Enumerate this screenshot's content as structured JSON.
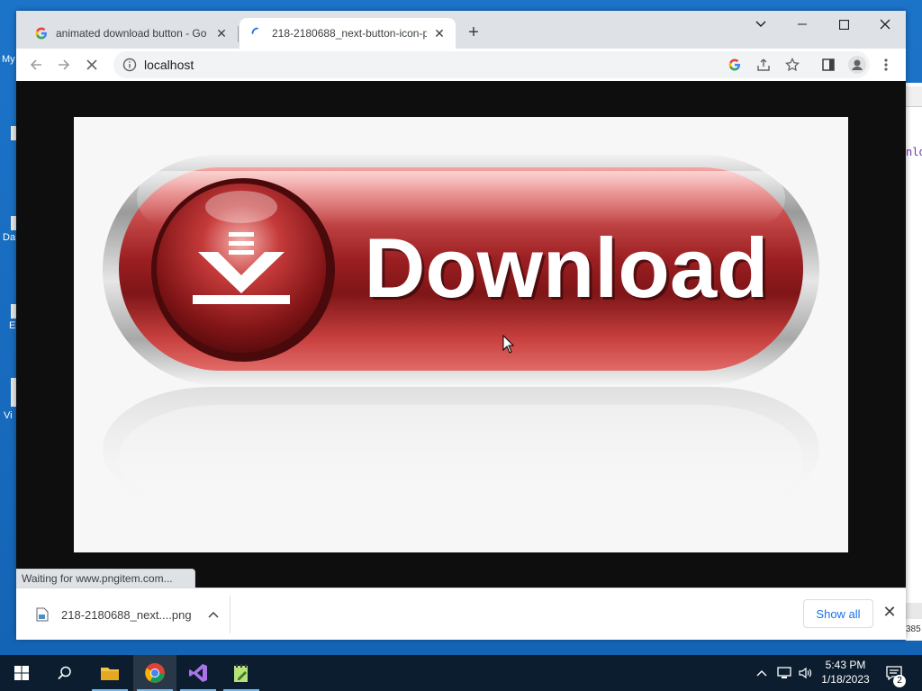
{
  "desktop": {
    "icon_labels": [
      "My",
      "Da",
      "E",
      "Vi"
    ]
  },
  "background_window": {
    "code_fragment": "nlo",
    "status_fragment": "385"
  },
  "browser": {
    "tabs": [
      {
        "title": "animated download button - Go",
        "favicon": "google-g-icon",
        "active": false
      },
      {
        "title": "218-2180688_next-button-icon-p",
        "favicon": "loading-spinner-icon",
        "active": true
      }
    ],
    "url": "localhost",
    "status_text": "Waiting for www.pngitem.com...",
    "image_text": "Download"
  },
  "download_bar": {
    "filename": "218-2180688_next....png",
    "show_all_label": "Show all"
  },
  "taskbar": {
    "time": "5:43 PM",
    "date": "1/18/2023",
    "notification_count": "2"
  },
  "colors": {
    "button_red": "#c0393b",
    "chrome_frame": "#dee1e6",
    "taskbar": "#0b1d2f",
    "link_blue": "#1a73e8"
  }
}
